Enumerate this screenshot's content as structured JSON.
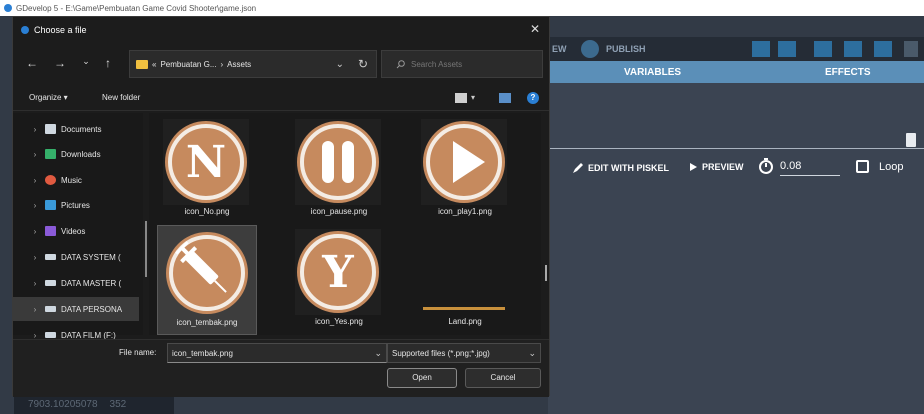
{
  "app": {
    "window_title": "GDevelop 5 - E:\\Game\\Pembuatan Game Covid Shooter\\game.json"
  },
  "background": {
    "toolbar": {
      "preview_partial": "EW",
      "publish_label": "PUBLISH"
    },
    "tabs": {
      "variables": "VARIABLES",
      "effects": "EFFECTS"
    },
    "actions": {
      "edit_with_piskel": "EDIT WITH PISKEL",
      "preview": "PREVIEW",
      "fps_value": "0.08",
      "loop_label": "Loop"
    },
    "status": {
      "coordinate": "7903.10205078",
      "other": "352"
    }
  },
  "dialog": {
    "title": "Choose a file",
    "close_label": "✕",
    "breadcrumb": {
      "prefix": "«",
      "parent": "Pembuatan G...",
      "separator": "›",
      "current": "Assets"
    },
    "search_placeholder": "Search Assets",
    "organize_label": "Organize ▾",
    "new_folder_label": "New folder",
    "help_label": "?",
    "sidebar": [
      {
        "label": "Documents",
        "icon": "documents-icon",
        "color": "#cfd8e0"
      },
      {
        "label": "Downloads",
        "icon": "downloads-icon",
        "color": "#35b06a"
      },
      {
        "label": "Music",
        "icon": "music-icon",
        "color": "#e05a40"
      },
      {
        "label": "Pictures",
        "icon": "pictures-icon",
        "color": "#3a9ad9"
      },
      {
        "label": "Videos",
        "icon": "videos-icon",
        "color": "#8a5ad8"
      },
      {
        "label": "DATA SYSTEM (",
        "icon": "drive-icon",
        "color": "#cfd8e0"
      },
      {
        "label": "DATA MASTER (",
        "icon": "drive-icon",
        "color": "#cfd8e0"
      },
      {
        "label": "DATA PERSONA",
        "icon": "drive-icon",
        "color": "#cfd8e0"
      },
      {
        "label": "DATA FILM (F:)",
        "icon": "drive-icon",
        "color": "#cfd8e0"
      }
    ],
    "files": [
      {
        "name": "icon_No.png",
        "icon": "letter-n-icon"
      },
      {
        "name": "icon_pause.png",
        "icon": "pause-icon"
      },
      {
        "name": "icon_play1.png",
        "icon": "play-icon"
      },
      {
        "name": "icon_tembak.png",
        "icon": "syringe-icon"
      },
      {
        "name": "icon_Yes.png",
        "icon": "letter-y-icon"
      },
      {
        "name": "Land.png",
        "icon": "land-strip-icon"
      }
    ],
    "file_name_label": "File name:",
    "file_name_value": "icon_tembak.png",
    "file_type_value": "Supported files (*.png;*.jpg)",
    "open_label": "Open",
    "cancel_label": "Cancel",
    "colors": {
      "icon_fill": "#c68a5e",
      "icon_ring": "#f4ece4",
      "accent": "#2a7fd4",
      "folder": "#f0c040"
    }
  }
}
